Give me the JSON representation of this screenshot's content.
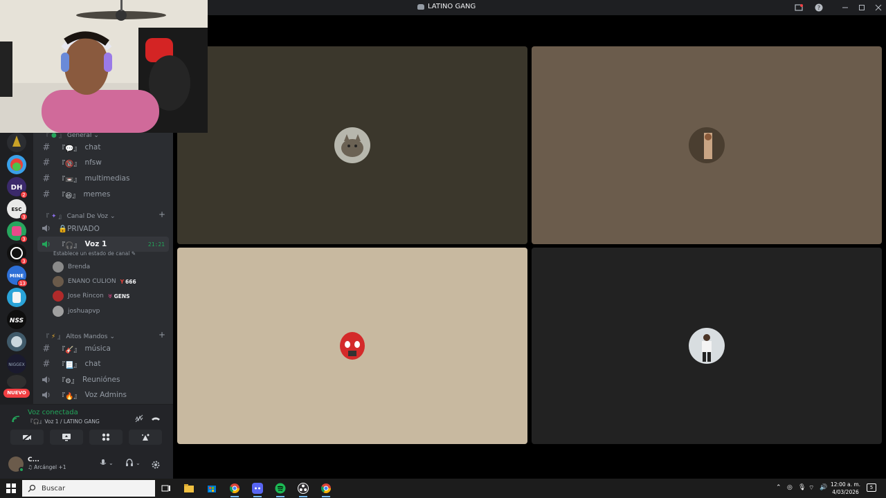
{
  "app": {
    "title": "LATINO GANG",
    "accent": "#23a55a",
    "danger": "#f23f43"
  },
  "server_rail": {
    "badges": [
      "2",
      "3",
      "3",
      "3",
      "13"
    ],
    "new_label": "NUEVO"
  },
  "categories": {
    "general": "General",
    "voice": "Canal De Voz",
    "altos": "Altos Mandos"
  },
  "text_channels": [
    {
      "emoji": "💬",
      "name": "chat"
    },
    {
      "emoji": "🔞",
      "name": "nfsw"
    },
    {
      "emoji": "📼",
      "name": "multimedias"
    },
    {
      "emoji": "😆",
      "name": "memes"
    }
  ],
  "voice_channels": {
    "privado": "🔒PRIVADO",
    "voz1": {
      "emoji": "『🎧』",
      "name": "Voz 1",
      "time": "21:21",
      "status": "Establece un estado de canal"
    },
    "users": [
      {
        "name": "Brenda",
        "tag": ""
      },
      {
        "name": "ENANO CULION",
        "tag": "666"
      },
      {
        "name": "Jose Rincon",
        "tag": "GENS"
      },
      {
        "name": "joshuapvp",
        "tag": ""
      }
    ]
  },
  "altos_channels": [
    {
      "emoji": "『🎸』",
      "name": "música",
      "type": "text"
    },
    {
      "emoji": "『📃』",
      "name": "chat",
      "type": "text"
    },
    {
      "emoji": "『⚙』",
      "name": "Reuniónes",
      "type": "voice"
    },
    {
      "emoji": "『🔥』",
      "name": "Voz Admins",
      "type": "voice"
    }
  ],
  "voice_panel": {
    "status": "Voz conectada",
    "location": "『🎧』Voz 1 / LATINO GANG"
  },
  "user": {
    "name": "C...",
    "activity": "♫ Arcángel +1"
  },
  "video_tiles": [
    {
      "bg": "#3b372c",
      "avatar": "cat"
    },
    {
      "bg": "#6b5c4c",
      "avatar": "person"
    },
    {
      "bg": "#c8b9a0",
      "avatar": "spider"
    },
    {
      "bg": "#222222",
      "avatar": "person-white"
    }
  ],
  "taskbar": {
    "search_placeholder": "Buscar",
    "time": "12:00 a. m.",
    "date": "4/03/2026",
    "notif": "5"
  }
}
